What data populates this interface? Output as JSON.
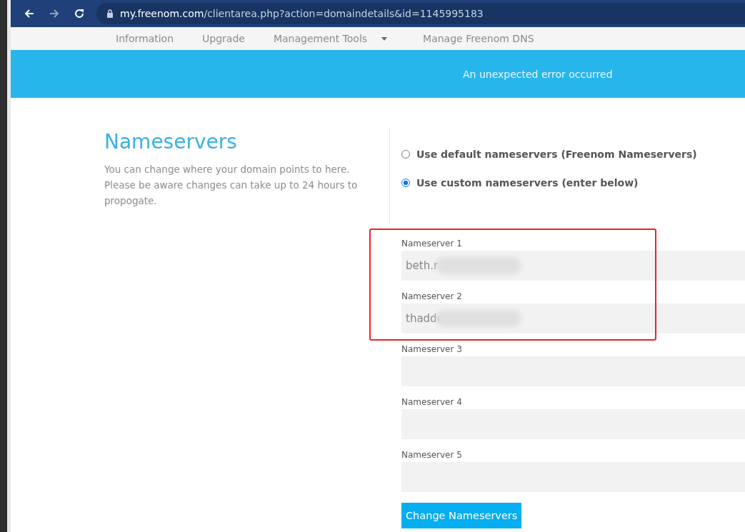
{
  "browser": {
    "url_host": "my.freenom.com",
    "url_path": "/clientarea.php?action=domaindetails&id=1145995183"
  },
  "nav": [
    {
      "label": "Information",
      "dropdown": false
    },
    {
      "label": "Upgrade",
      "dropdown": false
    },
    {
      "label": "Management Tools",
      "dropdown": true
    },
    {
      "label": "Manage Freenom DNS",
      "dropdown": false
    }
  ],
  "alert": "An unexpected error occurred",
  "intro": {
    "title": "Nameservers",
    "text": "You can change where your domain points to here. Please be aware changes can take up to 24 hours to propogate."
  },
  "options": [
    {
      "label": "Use default nameservers (Freenom Nameservers)",
      "selected": false
    },
    {
      "label": "Use custom nameservers (enter below)",
      "selected": true
    }
  ],
  "fields": [
    {
      "label": "Nameserver 1",
      "value": "beth.r",
      "redacted": true,
      "highlighted": true
    },
    {
      "label": "Nameserver 2",
      "value": "thadde",
      "redacted": true,
      "highlighted": true
    },
    {
      "label": "Nameserver 3",
      "redacted": false,
      "highlighted": false
    },
    {
      "label": "Nameserver 4",
      "redacted": false,
      "highlighted": false
    },
    {
      "label": "Nameserver 5",
      "redacted": false,
      "highlighted": false
    }
  ],
  "submit": "Change Nameservers"
}
